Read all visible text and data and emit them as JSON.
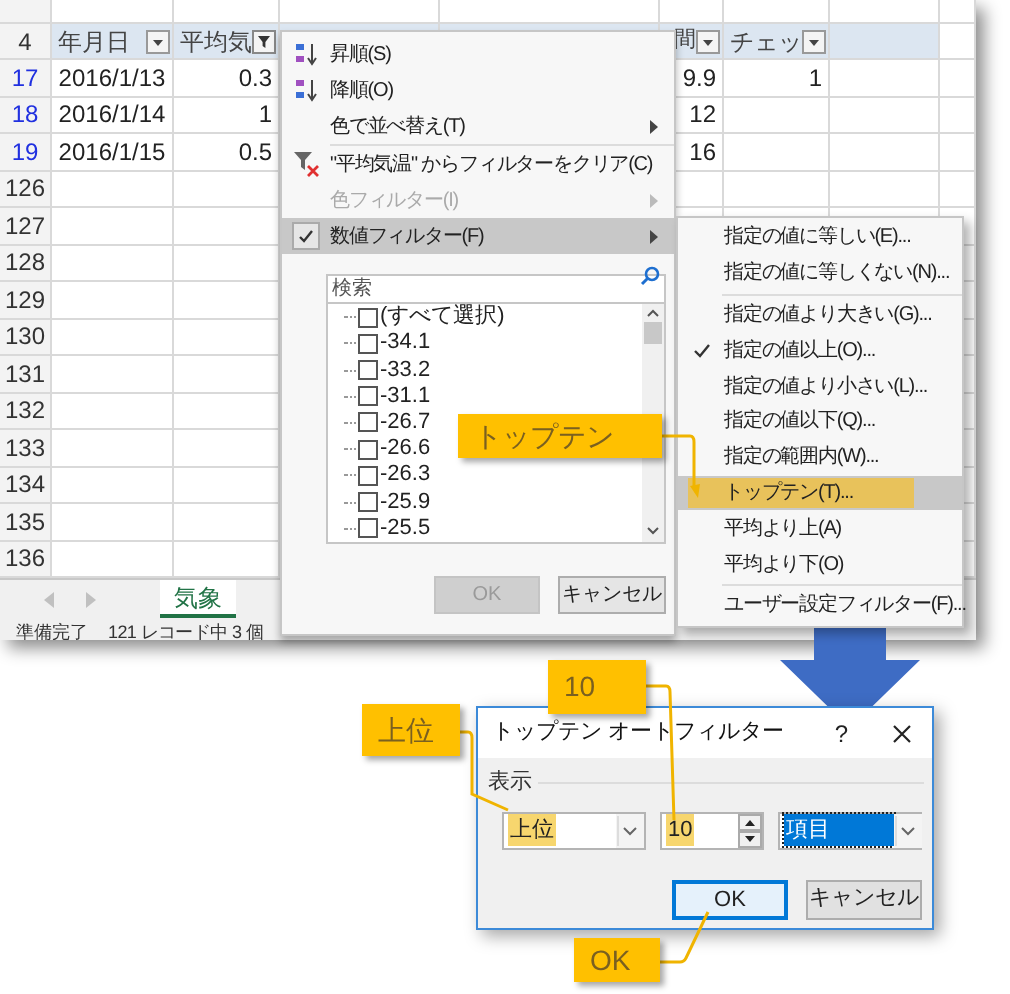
{
  "sheet": {
    "header": {
      "row": "4",
      "cells": [
        {
          "text": "年月日",
          "kind": "plain"
        },
        {
          "text": "平均気",
          "kind": "active"
        },
        {
          "text": "間",
          "kind": "plain"
        },
        {
          "text": "チェッ",
          "kind": "plain"
        }
      ]
    },
    "rows": [
      {
        "row": "17",
        "filtered": true,
        "cells": [
          "2016/1/13",
          "0.3",
          "9.9",
          "1"
        ]
      },
      {
        "row": "18",
        "filtered": true,
        "cells": [
          "2016/1/14",
          "1",
          "12"
        ]
      },
      {
        "row": "19",
        "filtered": true,
        "cells": [
          "2016/1/15",
          "0.5",
          "16"
        ]
      },
      {
        "row": "126",
        "filtered": false,
        "cells": []
      },
      {
        "row": "127",
        "filtered": false,
        "cells": []
      },
      {
        "row": "128",
        "filtered": false,
        "cells": []
      },
      {
        "row": "129",
        "filtered": false,
        "cells": []
      },
      {
        "row": "130",
        "filtered": false,
        "cells": []
      },
      {
        "row": "131",
        "filtered": false,
        "cells": []
      },
      {
        "row": "132",
        "filtered": false,
        "cells": []
      },
      {
        "row": "133",
        "filtered": false,
        "cells": []
      },
      {
        "row": "134",
        "filtered": false,
        "cells": []
      },
      {
        "row": "135",
        "filtered": false,
        "cells": []
      },
      {
        "row": "136",
        "filtered": false,
        "cells": []
      }
    ],
    "sheet_tabs": [
      {
        "label": "気象",
        "selected": true
      }
    ],
    "status_bar": {
      "state": "準備完了",
      "records": "121 レコード中 3 個"
    }
  },
  "filter_menu": {
    "items": [
      {
        "kind": "sort_asc",
        "label": "昇順(S)",
        "submenu": false,
        "disabled": false,
        "checked": false,
        "selected": false
      },
      {
        "kind": "sort_desc",
        "label": "降順(O)",
        "submenu": false,
        "disabled": false,
        "checked": false,
        "selected": false
      },
      {
        "kind": "command",
        "label": "色で並べ替え(T)",
        "submenu": true,
        "disabled": false,
        "checked": false,
        "selected": false
      },
      {
        "kind": "separator"
      },
      {
        "kind": "clear_filter",
        "label": "\"平均気温\" からフィルターをクリア(C)",
        "submenu": false,
        "disabled": false,
        "checked": false,
        "selected": false
      },
      {
        "kind": "command",
        "label": "色フィルター(I)",
        "submenu": true,
        "disabled": true,
        "checked": false,
        "selected": false
      },
      {
        "kind": "command",
        "label": "数値フィルター(F)",
        "submenu": true,
        "disabled": false,
        "checked": true,
        "selected": true
      }
    ],
    "search": {
      "placeholder": "検索"
    },
    "values": [
      {
        "label": "(すべて選択)",
        "checked": false
      },
      {
        "label": "-34.1",
        "checked": false
      },
      {
        "label": "-33.2",
        "checked": false
      },
      {
        "label": "-31.1",
        "checked": false
      },
      {
        "label": "-26.7",
        "checked": false
      },
      {
        "label": "-26.6",
        "checked": false
      },
      {
        "label": "-26.3",
        "checked": false
      },
      {
        "label": "-25.9",
        "checked": false
      },
      {
        "label": "-25.5",
        "checked": false
      }
    ],
    "buttons": [
      {
        "label": "OK",
        "disabled": true
      },
      {
        "label": "キャンセル",
        "disabled": false
      }
    ]
  },
  "number_filter_menu": {
    "items": [
      {
        "kind": "item",
        "label": "指定の値に等しい(E)...",
        "checked": false,
        "selected": false,
        "highlighted": false
      },
      {
        "kind": "item",
        "label": "指定の値に等しくない(N)...",
        "checked": false,
        "selected": false,
        "highlighted": false
      },
      {
        "kind": "separator"
      },
      {
        "kind": "item",
        "label": "指定の値より大きい(G)...",
        "checked": false,
        "selected": false,
        "highlighted": false
      },
      {
        "kind": "item",
        "label": "指定の値以上(O)...",
        "checked": true,
        "selected": false,
        "highlighted": false
      },
      {
        "kind": "item",
        "label": "指定の値より小さい(L)...",
        "checked": false,
        "selected": false,
        "highlighted": false
      },
      {
        "kind": "item",
        "label": "指定の値以下(Q)...",
        "checked": false,
        "selected": false,
        "highlighted": false
      },
      {
        "kind": "item",
        "label": "指定の範囲内(W)...",
        "checked": false,
        "selected": false,
        "highlighted": false
      },
      {
        "kind": "item",
        "label": "トップテン(T)...",
        "checked": false,
        "selected": true,
        "highlighted": true
      },
      {
        "kind": "item",
        "label": "平均より上(A)",
        "checked": false,
        "selected": false,
        "highlighted": false
      },
      {
        "kind": "item",
        "label": "平均より下(O)",
        "checked": false,
        "selected": false,
        "highlighted": false
      },
      {
        "kind": "separator"
      },
      {
        "kind": "item",
        "label": "ユーザー設定フィルター(F)...",
        "checked": false,
        "selected": false,
        "highlighted": false
      }
    ]
  },
  "dialog": {
    "title": "トップテン オートフィルター",
    "help": "?",
    "group_label": "表示",
    "fields": [
      {
        "kind": "combo",
        "value": "上位",
        "selected": false,
        "highlighted": true
      },
      {
        "kind": "spinner",
        "value": "10",
        "selected": false,
        "highlighted": true
      },
      {
        "kind": "combo",
        "value": "項目",
        "selected": true,
        "highlighted": false
      }
    ],
    "buttons": [
      {
        "label": "OK",
        "default": true
      },
      {
        "label": "キャンセル",
        "default": false
      }
    ]
  },
  "callouts": [
    {
      "text": "トップテン"
    },
    {
      "text": "10"
    },
    {
      "text": "上位"
    },
    {
      "text": "OK"
    }
  ]
}
